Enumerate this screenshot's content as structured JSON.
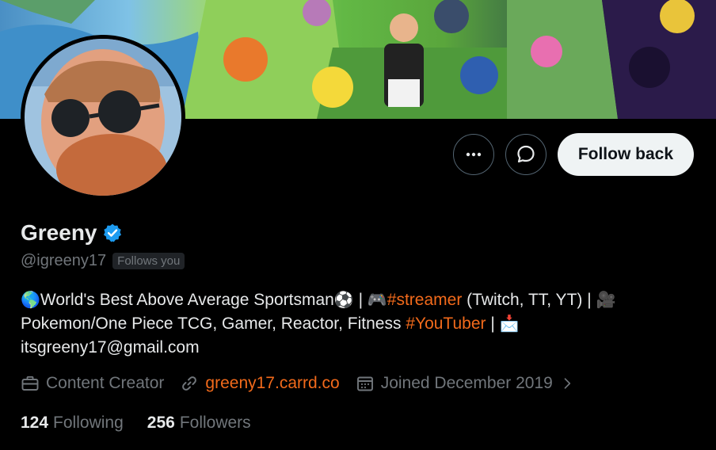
{
  "profile": {
    "name": "Greeny",
    "handle": "@igreeny17",
    "follows_you": "Follows you",
    "verified": true
  },
  "actions": {
    "more_icon": "more-dots-icon",
    "message_icon": "message-icon",
    "follow_label": "Follow back"
  },
  "bio": {
    "part1": "World's Best Above Average Sportsman",
    "sep1": " | ",
    "tag1": "#streamer",
    "part2": " (Twitch, TT, YT) | ",
    "part3": "Pokemon/One Piece TCG, Gamer, Reactor, Fitness ",
    "tag2": "#YouTuber",
    "sep2": " | ",
    "email": "itsgreeny17@gmail.com",
    "emoji_globe": "🌎",
    "emoji_ball": "⚽",
    "emoji_game": "🎮",
    "emoji_camera": "🎥",
    "emoji_mail": "📩"
  },
  "meta": {
    "category": "Content Creator",
    "link": "greeny17.carrd.co",
    "joined": "Joined December 2019"
  },
  "stats": {
    "following_count": "124",
    "following_label": "Following",
    "followers_count": "256",
    "followers_label": "Followers"
  },
  "colors": {
    "accent_link": "#f26a1b",
    "verified": "#1d9bf0",
    "muted": "#71767b",
    "text": "#e7e9ea",
    "background": "#000000"
  }
}
